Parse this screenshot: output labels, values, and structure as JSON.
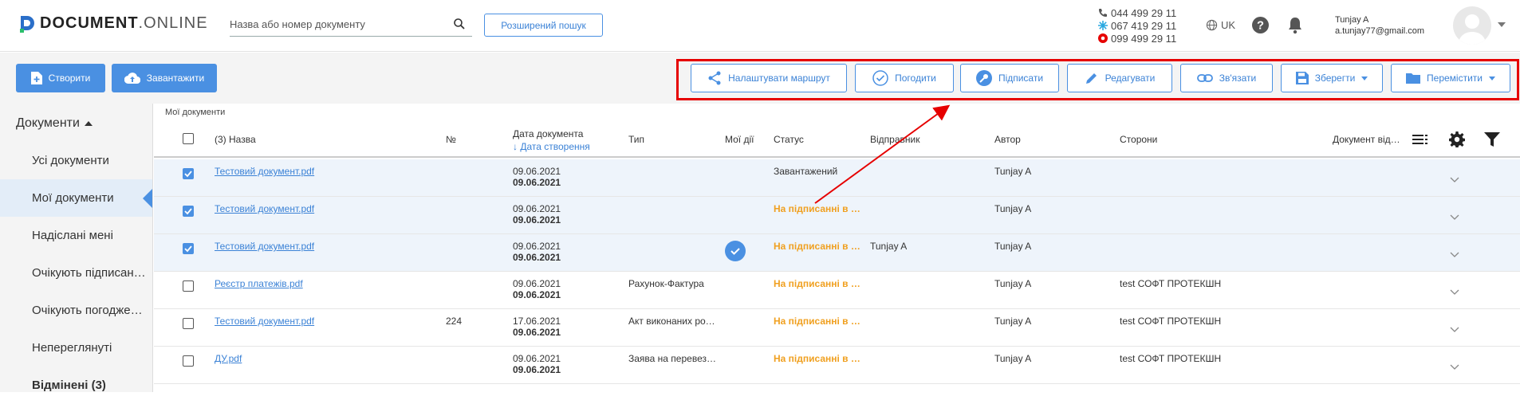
{
  "header": {
    "logo_doc": "DOCUMENT",
    "logo_online": ".ONLINE",
    "search_placeholder": "Назва або номер документу",
    "advanced_search": "Розширений пошук",
    "phones": [
      "044 499 29 11",
      "067 419 29 11",
      "099 499 29 11"
    ],
    "lang": "UK",
    "user_name": "Tunjay A",
    "user_email": "a.tunjay77@gmail.com"
  },
  "toolbar": {
    "create": "Створити",
    "upload": "Завантажити",
    "route": "Налаштувати маршрут",
    "approve": "Погодити",
    "sign": "Підписати",
    "edit": "Редагувати",
    "link": "Зв'язати",
    "save": "Зберегти",
    "move": "Перемістити"
  },
  "sidebar": {
    "header": "Документи",
    "items": [
      {
        "label": "Усі документи"
      },
      {
        "label": "Мої документи"
      },
      {
        "label": "Надіслані мені"
      },
      {
        "label": "Очікують підписан…"
      },
      {
        "label": "Очікують погодже…"
      },
      {
        "label": "Непереглянуті"
      },
      {
        "label": "Відмінені (3)"
      }
    ]
  },
  "content": {
    "breadcrumb": "Мої документи",
    "columns": {
      "name": "(3) Назва",
      "num": "№",
      "date": "Дата документа",
      "date_sub": "↓ Дата створення",
      "type": "Тип",
      "my_actions": "Мої дії",
      "status": "Статус",
      "sender": "Відправник",
      "author": "Автор",
      "parties": "Сторони",
      "doc_from": "Документ від…"
    },
    "rows": [
      {
        "checked": true,
        "name": "Тестовий документ.pdf",
        "num": "",
        "date1": "09.06.2021",
        "date2": "09.06.2021",
        "type": "",
        "my_action": false,
        "status": "Завантажений",
        "status_kind": "plain",
        "sender": "",
        "author": "Tunjay A",
        "parties": ""
      },
      {
        "checked": true,
        "name": "Тестовий документ.pdf",
        "num": "",
        "date1": "09.06.2021",
        "date2": "09.06.2021",
        "type": "",
        "my_action": false,
        "status": "На підписанні в о…",
        "status_kind": "orange",
        "sender": "",
        "author": "Tunjay A",
        "parties": ""
      },
      {
        "checked": true,
        "name": "Тестовий документ.pdf",
        "num": "",
        "date1": "09.06.2021",
        "date2": "09.06.2021",
        "type": "",
        "my_action": true,
        "status": "На підписанні в о…",
        "status_kind": "orange",
        "sender": "Tunjay A",
        "author": "Tunjay A",
        "parties": ""
      },
      {
        "checked": false,
        "name": "Реєстр платежів.pdf",
        "num": "",
        "date1": "09.06.2021",
        "date2": "09.06.2021",
        "type": "Рахунок-Фактура",
        "my_action": false,
        "status": "На підписанні в о…",
        "status_kind": "orange",
        "sender": "",
        "author": "Tunjay A",
        "parties": "test СОФТ ПРОТЕКШН"
      },
      {
        "checked": false,
        "name": "Тестовий документ.pdf",
        "num": "224",
        "date1": "17.06.2021",
        "date2": "09.06.2021",
        "type": "Акт виконаних ро…",
        "my_action": false,
        "status": "На підписанні в о…",
        "status_kind": "orange",
        "sender": "",
        "author": "Tunjay A",
        "parties": "test СОФТ ПРОТЕКШН"
      },
      {
        "checked": false,
        "name": "ДУ.pdf",
        "num": "",
        "date1": "09.06.2021",
        "date2": "09.06.2021",
        "type": "Заява на перевез…",
        "my_action": false,
        "status": "На підписанні в о…",
        "status_kind": "orange",
        "sender": "",
        "author": "Tunjay A",
        "parties": "test СОФТ ПРОТЕКШН"
      }
    ]
  },
  "colors": {
    "accent": "#4a90e2",
    "highlight": "#e60000",
    "status_orange": "#f0a020"
  }
}
